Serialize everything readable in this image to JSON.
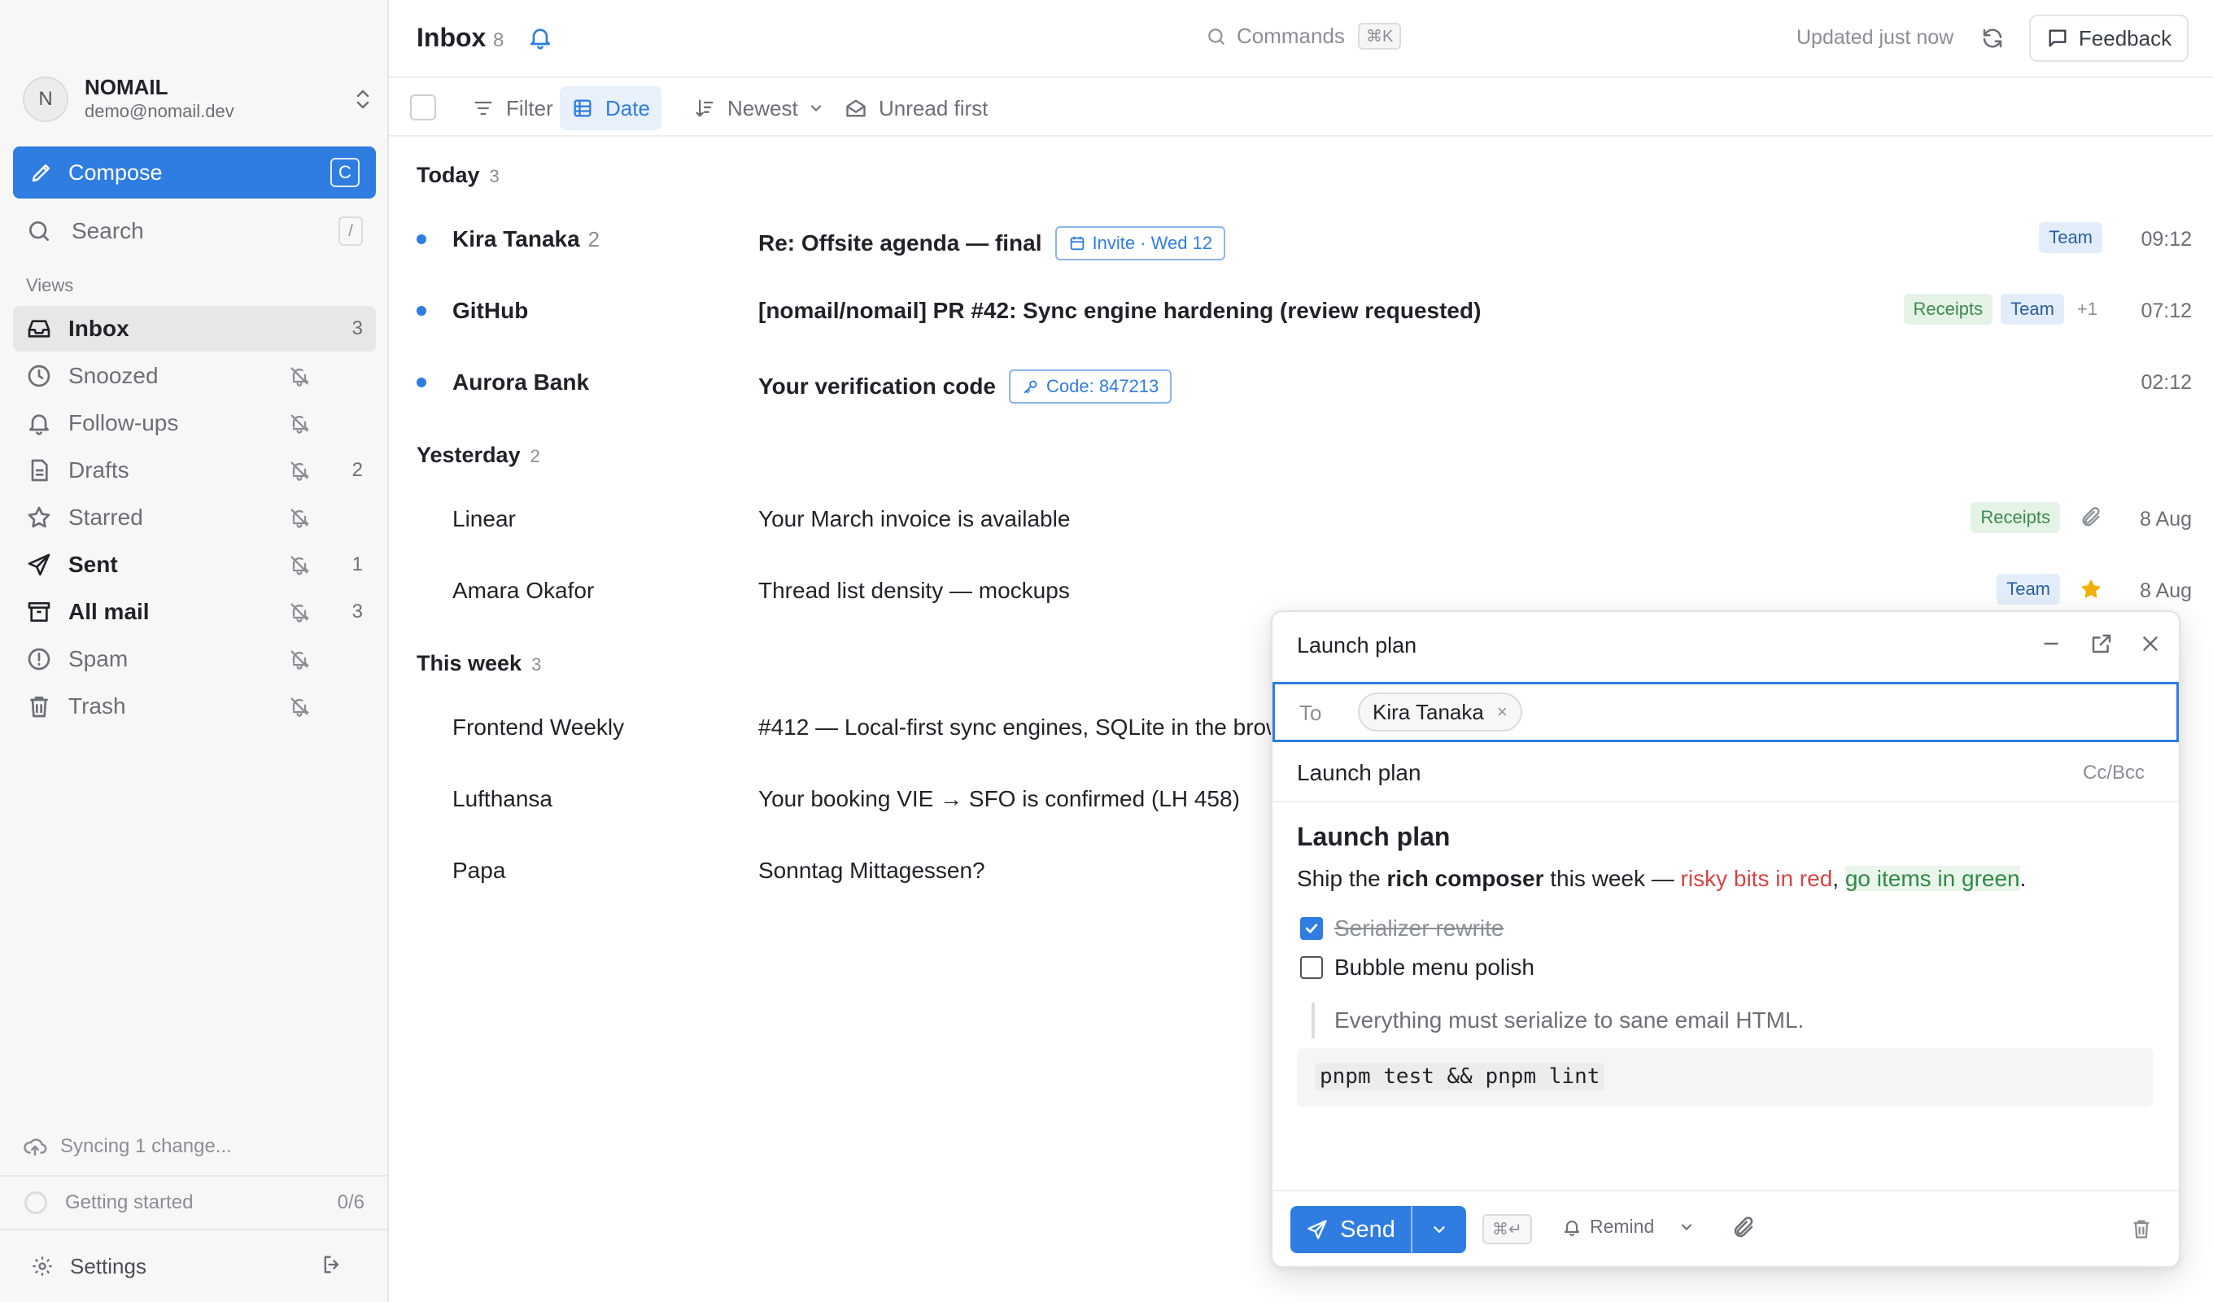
{
  "account": {
    "initial": "N",
    "name": "NOMAIL",
    "email": "demo@nomail.dev"
  },
  "sidebar": {
    "compose_label": "Compose",
    "compose_shortcut": "C",
    "search_label": "Search",
    "search_shortcut": "/",
    "views_heading": "Views",
    "items": [
      {
        "label": "Inbox",
        "count": "3",
        "icon": "inbox-icon",
        "active": true
      },
      {
        "label": "Snoozed",
        "count": "",
        "icon": "clock-icon"
      },
      {
        "label": "Follow-ups",
        "count": "",
        "icon": "bell-icon"
      },
      {
        "label": "Drafts",
        "count": "2",
        "icon": "file-icon"
      },
      {
        "label": "Starred",
        "count": "",
        "icon": "star-icon"
      },
      {
        "label": "Sent",
        "count": "1",
        "icon": "send-icon"
      },
      {
        "label": "All mail",
        "count": "3",
        "icon": "archive-icon"
      },
      {
        "label": "Spam",
        "count": "",
        "icon": "alert-circle-icon"
      },
      {
        "label": "Trash",
        "count": "",
        "icon": "trash-icon"
      }
    ],
    "sync_status": "Syncing 1 change...",
    "getting_started_label": "Getting started",
    "getting_started_progress": "0/6",
    "settings_label": "Settings"
  },
  "header": {
    "title": "Inbox",
    "count": "8",
    "commands_label": "Commands",
    "commands_shortcut": "⌘K",
    "updated_text": "Updated just now",
    "feedback_label": "Feedback"
  },
  "toolbar": {
    "filter_label": "Filter",
    "date_label": "Date",
    "sort_label": "Newest",
    "unread_first_label": "Unread first"
  },
  "groups": [
    {
      "name": "Today",
      "count": "3"
    },
    {
      "name": "Yesterday",
      "count": "2"
    },
    {
      "name": "This week",
      "count": "3"
    }
  ],
  "mails": [
    {
      "sender": "Kira Tanaka",
      "thread_count": "2",
      "subject": "Re: Offsite agenda — final",
      "chip": "Invite · Wed 12",
      "labels": [
        "Team"
      ],
      "time": "09:12",
      "unread": true
    },
    {
      "sender": "GitHub",
      "thread_count": "",
      "subject": "[nomail/nomail] PR #42: Sync engine hardening (review requested)",
      "labels": [
        "Receipts",
        "Team"
      ],
      "more_labels": "+1",
      "time": "07:12",
      "unread": true
    },
    {
      "sender": "Aurora Bank",
      "thread_count": "",
      "subject": "Your verification code",
      "chip": "Code: 847213",
      "labels": [],
      "time": "02:12",
      "unread": true
    },
    {
      "sender": "Linear",
      "subject": "Your March invoice is available",
      "labels": [
        "Receipts"
      ],
      "has_attachment": true,
      "time": "8 Aug",
      "unread": false
    },
    {
      "sender": "Amara Okafor",
      "subject": "Thread list density — mockups",
      "labels": [
        "Team"
      ],
      "starred": true,
      "time": "8 Aug",
      "unread": false
    },
    {
      "sender": "Frontend Weekly",
      "subject": "#412 — Local-first sync engines, SQLite in the brow",
      "labels": [],
      "time": "",
      "unread": false
    },
    {
      "sender": "Lufthansa",
      "subject": "Your booking VIE → SFO is confirmed (LH 458)",
      "labels": [],
      "time": "",
      "unread": false
    },
    {
      "sender": "Papa",
      "subject": "Sonntag Mittagessen?",
      "labels": [],
      "time": "",
      "unread": false
    }
  ],
  "composer": {
    "window_title": "Launch plan",
    "to_label": "To",
    "recipient": "Kira Tanaka",
    "remove_recipient": "×",
    "subject": "Launch plan",
    "cc_bcc_label": "Cc/Bcc",
    "body": {
      "heading": "Launch plan",
      "p_start": "Ship the ",
      "p_bold": "rich composer",
      "p_mid": " this week — ",
      "p_red": "risky bits in red",
      "p_comma": ", ",
      "p_green": "go items in green",
      "p_end": ".",
      "tasks": [
        {
          "text": "Serializer rewrite",
          "checked": true
        },
        {
          "text": "Bubble menu polish",
          "checked": false
        }
      ],
      "quote": "Everything must serialize to sane email HTML.",
      "code": "pnpm test && pnpm lint"
    },
    "send_label": "Send",
    "send_shortcut": "⌘↵",
    "remind_label": "Remind"
  },
  "colors": {
    "accent": "#2f7de1",
    "team_label_bg": "#e3edf9",
    "receipts_label_bg": "#e4f3e6",
    "star": "#f2b100",
    "text_red": "#d64545",
    "text_green": "#2f8a46"
  }
}
